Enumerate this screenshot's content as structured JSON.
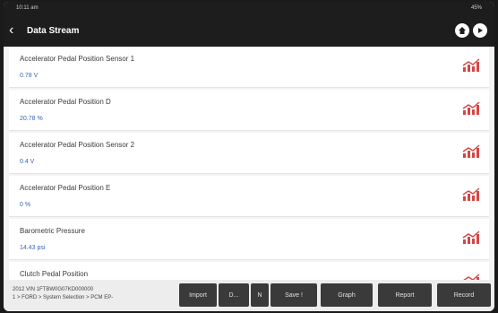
{
  "app": {
    "title": "Data Stream"
  },
  "status": {
    "time": "10:11 am",
    "battery": "45%"
  },
  "rows": [
    {
      "name": "Accelerator Pedal Position Sensor 1",
      "value": "0.78  V"
    },
    {
      "name": "Accelerator Pedal Position D",
      "value": "20.78  %"
    },
    {
      "name": "Accelerator Pedal Position Sensor 2",
      "value": "0.4  V"
    },
    {
      "name": "Accelerator Pedal Position E",
      "value": "0  %"
    },
    {
      "name": "Barometric Pressure",
      "value": "14.43  psi"
    },
    {
      "name": "Clutch Pedal Position",
      "value": ""
    }
  ],
  "footer": {
    "line1": "2012   VIN   1FTBW0G07KD000000",
    "line2": "1 > FORD > System Selection > PCM   EP-"
  },
  "buttons": {
    "import": "Import",
    "delete": "D...",
    "prefix": "N",
    "save": "Save !",
    "graph": "Graph",
    "report": "Report",
    "record": "Record"
  },
  "colors": {
    "accent": "#d64545",
    "value_text": "#3a62b8",
    "bar": "#1d1d1d",
    "button": "#3a3a3a"
  },
  "icons": [
    "back-arrow-icon",
    "home-icon",
    "exit-icon",
    "graph-icon"
  ]
}
